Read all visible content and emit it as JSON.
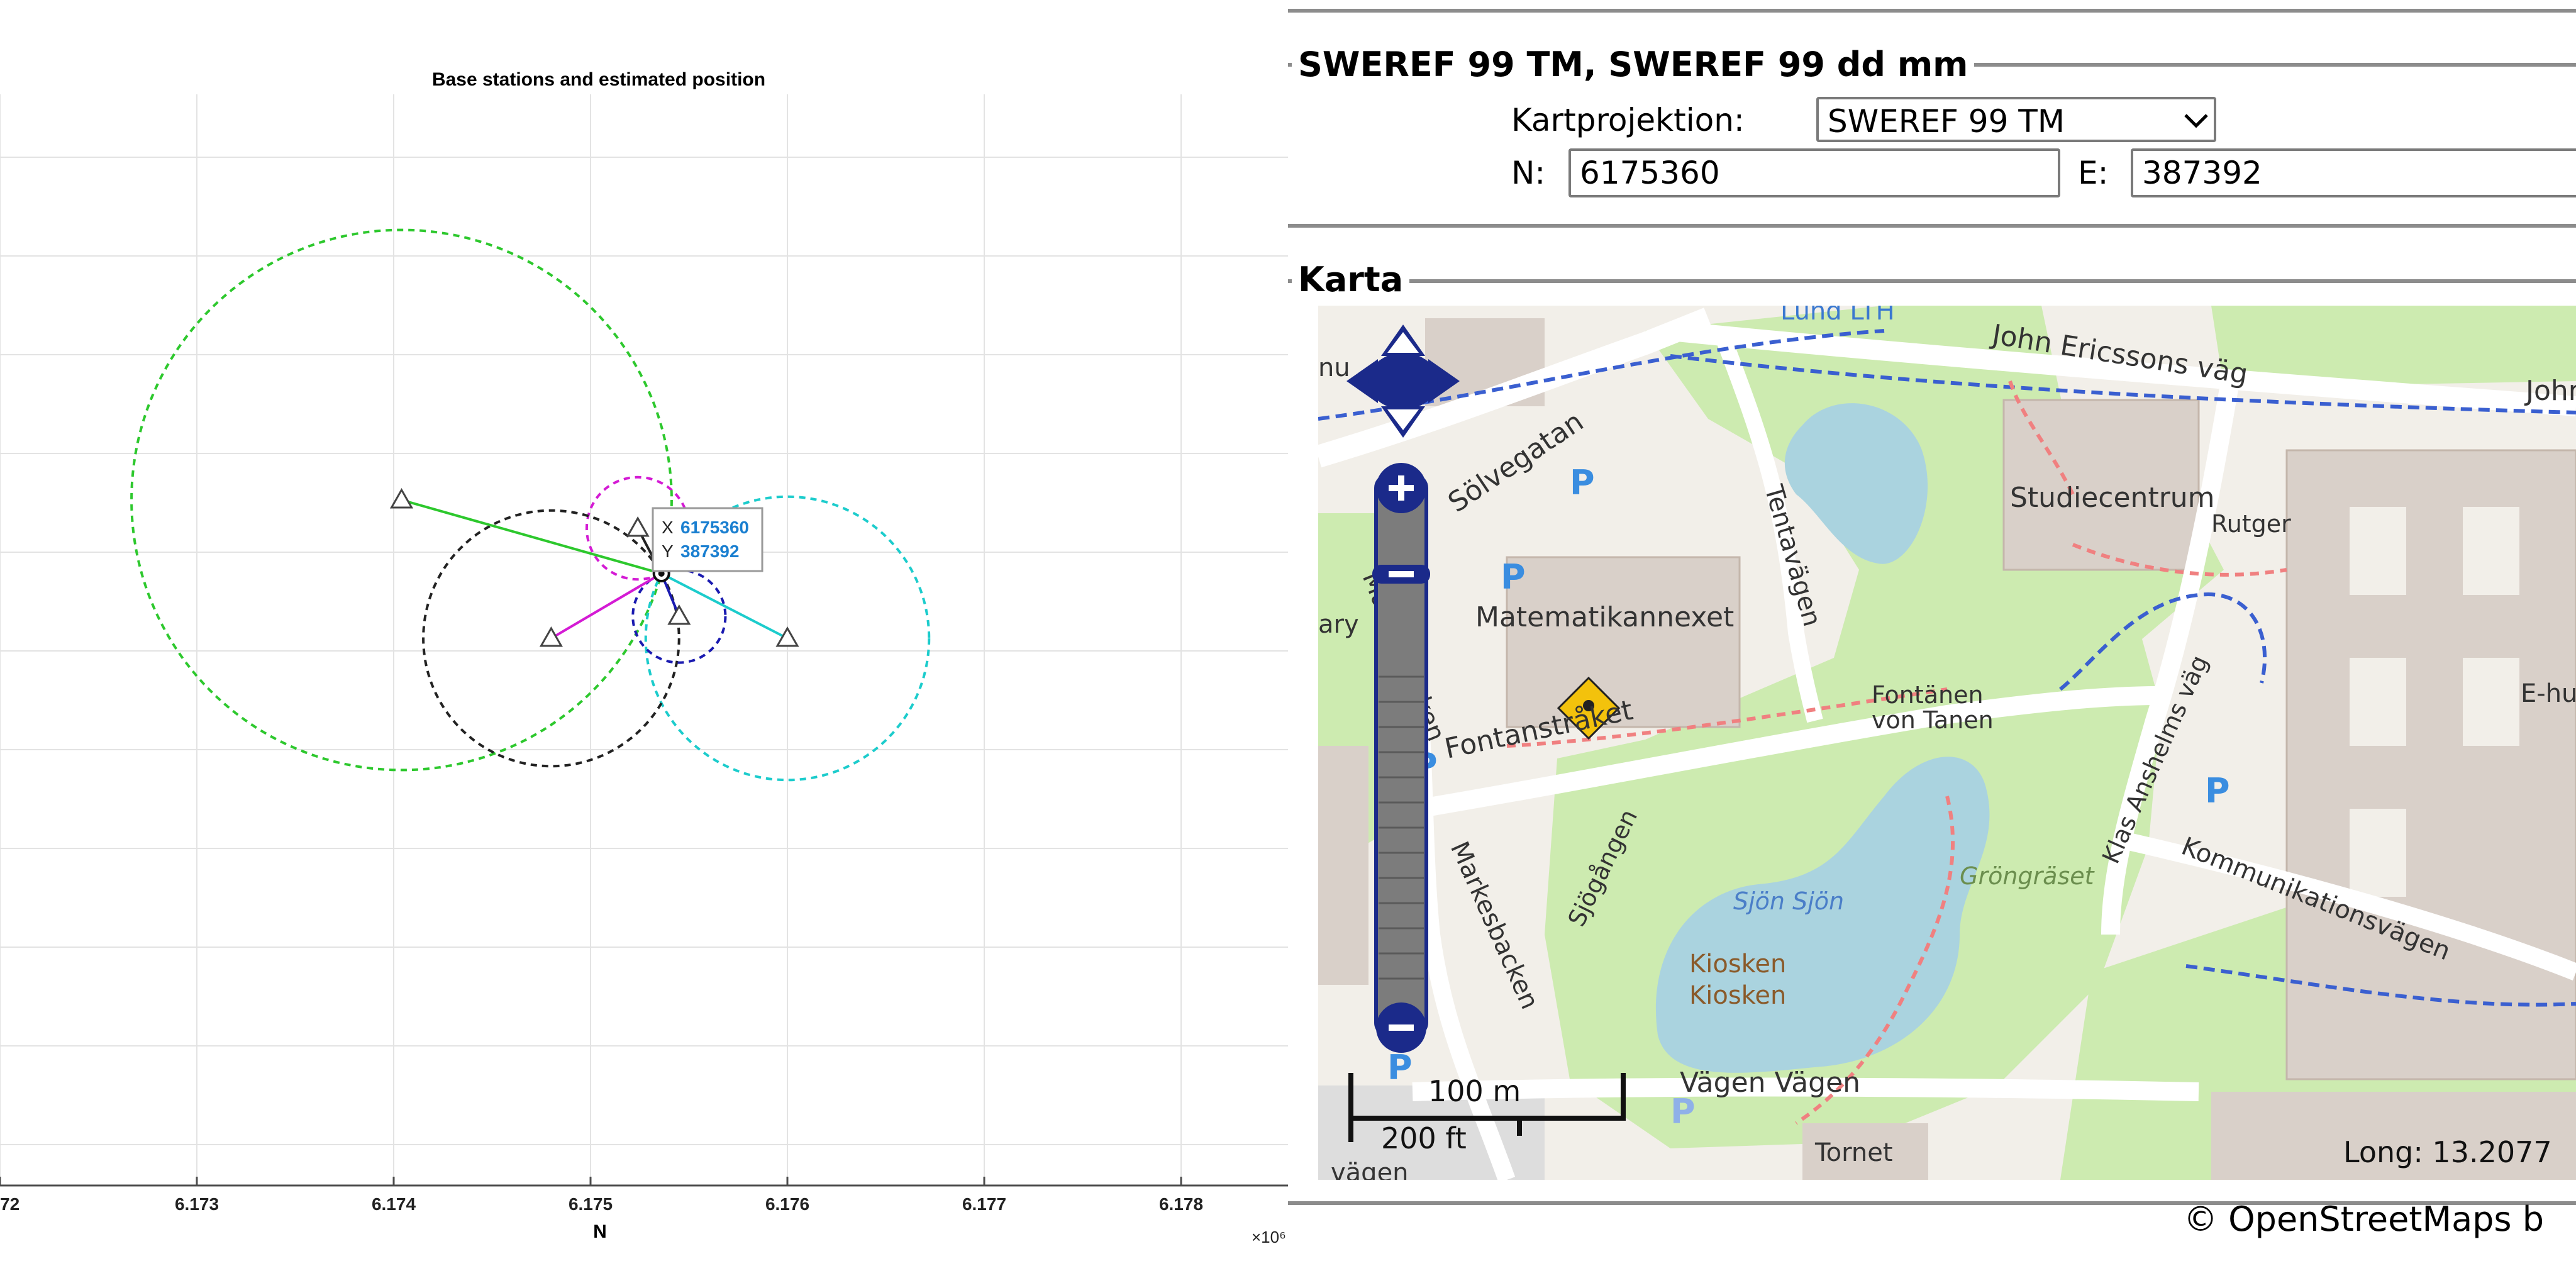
{
  "plot": {
    "title": "Base stations and estimated position",
    "xlabel": "N",
    "x_ticks": [
      "72",
      "6.173",
      "6.174",
      "6.175",
      "6.176",
      "6.177",
      "6.178"
    ],
    "x_exponent": "×10⁶",
    "datatip": {
      "x_label": "X",
      "x_value": "6175360",
      "y_label": "Y",
      "y_value": "387392"
    }
  },
  "chart_data": {
    "type": "scatter",
    "title": "Base stations and estimated position",
    "xlabel": "N",
    "ylabel": "",
    "xlim": [
      6172000,
      6178600
    ],
    "x_tick_labels": [
      "72",
      "6.173",
      "6.174",
      "6.175",
      "6.176",
      "6.177",
      "6.178"
    ],
    "x_tick_values": [
      6172000,
      6173000,
      6174000,
      6175000,
      6176000,
      6177000,
      6178000
    ],
    "x_multiplier": "10^6",
    "grid": "on",
    "series": [
      {
        "marker": "triangle",
        "x": [
          6174040,
          6174800,
          6175240,
          6175450,
          6176000
        ]
      },
      {
        "marker": "circle",
        "x": [
          6175360
        ],
        "y": [
          387392
        ]
      }
    ],
    "circles": [
      {
        "color": "#d41bd4",
        "center_station": 3,
        "style": "dashed"
      },
      {
        "color": "#2dc82d",
        "center_station": 1,
        "style": "dashed"
      },
      {
        "color": "#1ccccc",
        "center_station": 5,
        "style": "dashed"
      },
      {
        "color": "#222222",
        "center_station": 2,
        "style": "dashed"
      },
      {
        "color": "#1a1ab0",
        "center_station": 4,
        "style": "dashed"
      }
    ],
    "estimated_position": {
      "x": 6175360,
      "y": 387392
    }
  },
  "panel": {
    "coord_legend": "SWEREF 99 TM, SWEREF 99 dd mm",
    "projection_label": "Kartprojektion:",
    "projection_value": "SWEREF 99 TM",
    "n_label": "N:",
    "n_value": "6175360",
    "e_label": "E:",
    "e_value": "387392",
    "map_legend": "Karta"
  },
  "map": {
    "labels": {
      "lund_lth": "Lund LTH",
      "john_ericssons": "John Ericssons väg",
      "john2": "Johr",
      "solvegatan": "Sölvegatan",
      "studiecentrum": "Studiecentrum",
      "rutger": "Rutger",
      "tentavagen": "Tentavägen",
      "matematikannexet": "Matematikannexet",
      "ary": "ary",
      "markesbacken1": "Markesbacken",
      "fontanstraket": "Fontanstråket",
      "fontanen": "Fontänen",
      "von_tanen": "von Tanen",
      "klas_anshelms": "Klas Anshelms väg",
      "ehu": "E-hu",
      "sjogangen": "Sjögången",
      "sjon_sjon": "Sjön Sjön",
      "grongraset": "Gröngräset",
      "kommunikationsvagen": "Kommunikationsvägen",
      "markesbacken2": "Markesbacken",
      "kiosken1": "Kiosken",
      "kiosken2": "Kiosken",
      "vagen": "Vägen Vägen",
      "tornet": "Tornet",
      "vagen_bottom": "vägen",
      "nu": "nu"
    },
    "scale_m": "100 m",
    "scale_ft": "200 ft",
    "long_readout": "Long: 13.2077",
    "copyright": "© OpenStreetMaps b"
  },
  "colors": {
    "accent_blue": "#2b8cd6",
    "nav_blue": "#1b2a8a",
    "water": "#aad3df",
    "park": "#cdebb0",
    "building": "#d9d0c9"
  }
}
